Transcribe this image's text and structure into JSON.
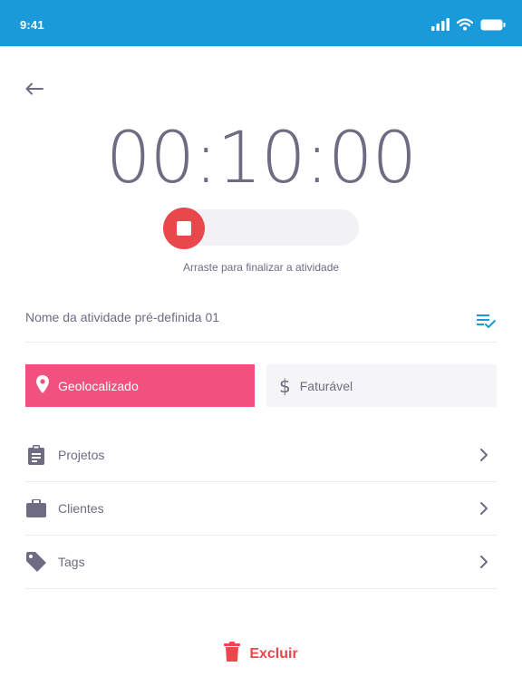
{
  "status_bar": {
    "time": "9:41"
  },
  "timer": {
    "display": "00:10:00"
  },
  "slider": {
    "hint": "Arraste para finalizar a atividade"
  },
  "activity": {
    "name": "Nome da atividade pré-definida 01"
  },
  "toggles": {
    "geo_label": "Geolocalizado",
    "billable_label": "Faturável"
  },
  "menu": {
    "items": [
      {
        "label": "Projetos",
        "icon": "clipboard-icon"
      },
      {
        "label": "Clientes",
        "icon": "briefcase-icon"
      },
      {
        "label": "Tags",
        "icon": "tag-icon"
      }
    ]
  },
  "delete": {
    "label": "Excluir"
  },
  "colors": {
    "status_bar": "#1b9ad9",
    "accent_red": "#e8474c",
    "geo_pink": "#f0517e",
    "text": "#6e6b82"
  }
}
